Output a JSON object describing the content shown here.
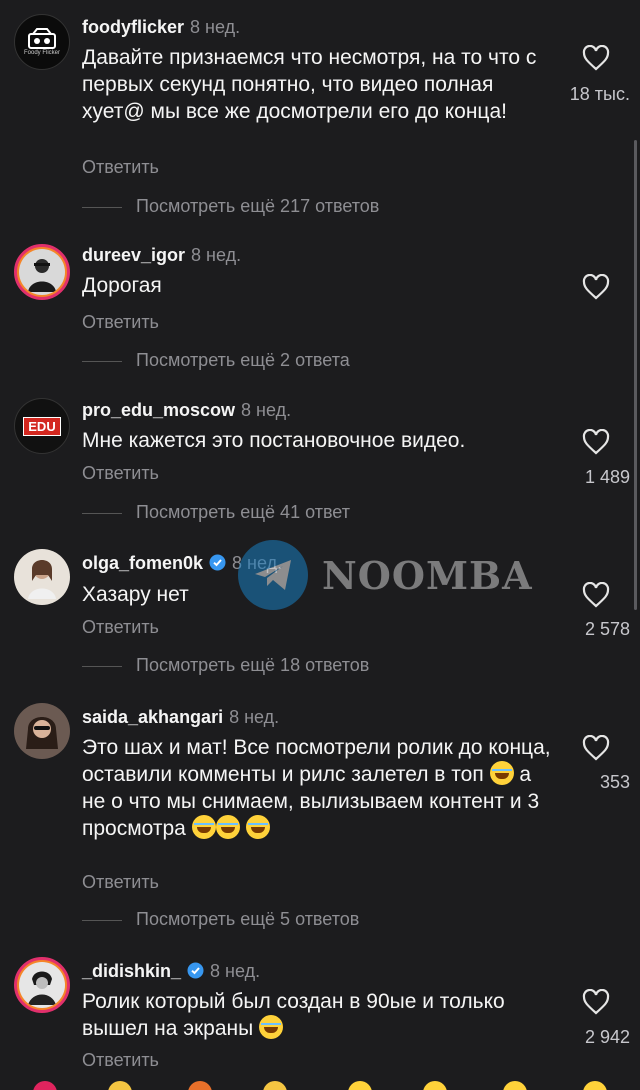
{
  "colors": {
    "background": "#1c1c1e",
    "text": "#f5f5f5",
    "muted": "#8e8e93",
    "verified": "#3797f0"
  },
  "icons": {
    "like": "heart-outline-icon",
    "verified": "verified-badge-icon",
    "emoji": "face-with-tears-of-joy-emoji"
  },
  "labels": {
    "reply": "Ответить"
  },
  "watermark": {
    "text": "NOOMBA"
  },
  "comments": [
    {
      "username": "foodyflicker",
      "time": "8 нед.",
      "avatar_text": "Foody Flicker",
      "text": "Давайте признаемся что несмотря, на то что с первых секунд понятно, что видео полная хует@ мы все же досмотрели его до конца!",
      "likes": "18 тыс.",
      "more": "Посмотреть ещё 217 ответов"
    },
    {
      "username": "dureev_igor",
      "time": "8 нед.",
      "text": "Дорогая",
      "likes": "",
      "more": "Посмотреть ещё 2 ответа"
    },
    {
      "username": "pro_edu_moscow",
      "time": "8 нед.",
      "avatar_text": "EDU",
      "text": "Мне кажется это постановочное видео.",
      "likes": "1 489",
      "more": "Посмотреть ещё 41 ответ"
    },
    {
      "username": "olga_fomen0k",
      "time": "8 нед.",
      "text": "Хазару нет",
      "likes": "2 578",
      "more": "Посмотреть ещё 18 ответов"
    },
    {
      "username": "saida_akhangari",
      "time": "8 нед.",
      "text_parts": [
        "Это шах и мат!  Все посмотрели ролик до конца, оставили комменты и рилс залетел в топ ",
        "а не о что мы снимаем, вылизываем контент и 3 просмотра "
      ],
      "likes": "353",
      "more": "Посмотреть ещё 5 ответов"
    },
    {
      "username": "_didishkin_",
      "time": "8 нед.",
      "text": "Ролик который был создан в 90ые и только вышел на экраны ",
      "likes": "2 942"
    }
  ]
}
